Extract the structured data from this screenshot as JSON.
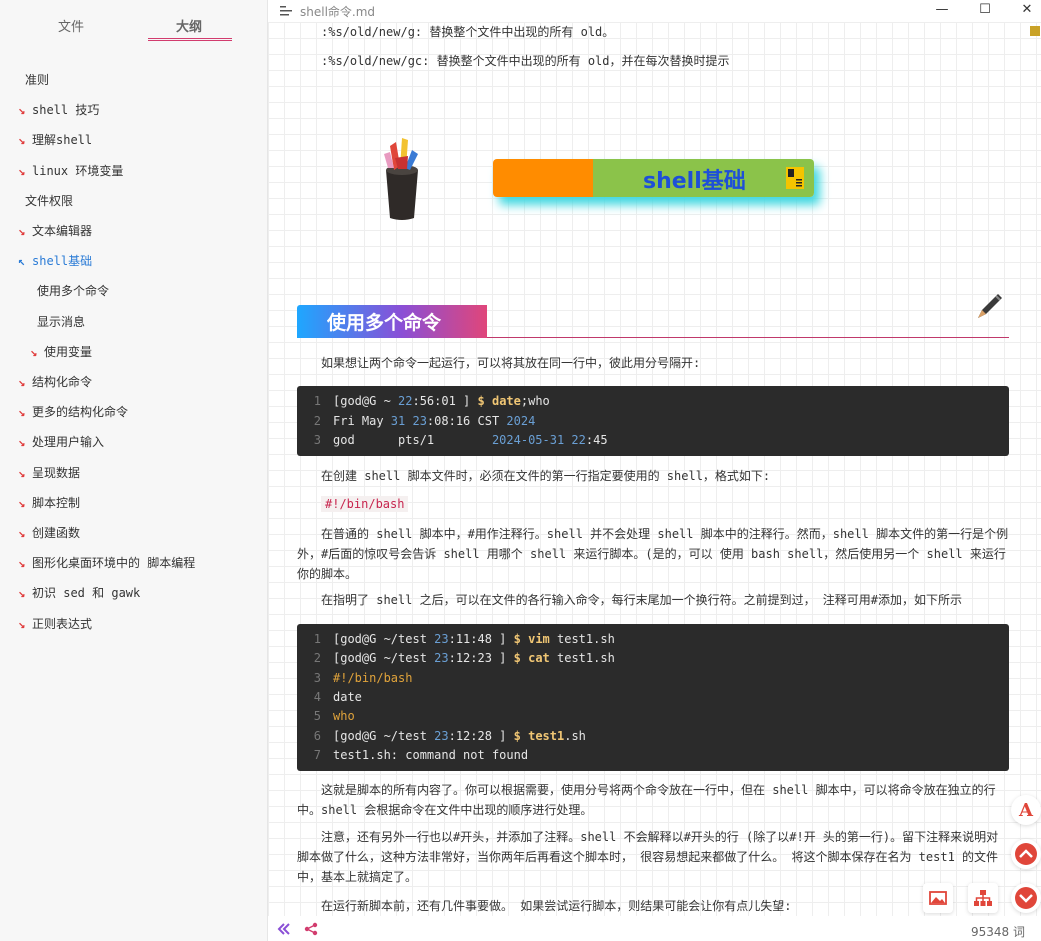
{
  "window": {
    "title": "shell命令.md",
    "minimize_glyph": "—",
    "maximize_glyph": "☐",
    "close_glyph": "✕"
  },
  "sidebar": {
    "tabs": [
      {
        "label": "文件",
        "active": false
      },
      {
        "label": "大纲",
        "active": true
      }
    ],
    "outline": [
      {
        "label": "准则",
        "level": 1,
        "collapsible": false,
        "active": false
      },
      {
        "label": "shell 技巧",
        "level": 1,
        "collapsible": true,
        "active": false
      },
      {
        "label": "理解shell",
        "level": 1,
        "collapsible": true,
        "active": false
      },
      {
        "label": "linux 环境变量",
        "level": 1,
        "collapsible": true,
        "active": false
      },
      {
        "label": "文件权限",
        "level": 1,
        "collapsible": false,
        "active": false
      },
      {
        "label": "文本编辑器",
        "level": 1,
        "collapsible": true,
        "active": false
      },
      {
        "label": "shell基础",
        "level": 1,
        "collapsible": true,
        "active": true
      },
      {
        "label": "使用多个命令",
        "level": 2,
        "collapsible": false,
        "active": false
      },
      {
        "label": "显示消息",
        "level": 2,
        "collapsible": false,
        "active": false
      },
      {
        "label": "使用变量",
        "level": 2,
        "collapsible": true,
        "active": false
      },
      {
        "label": "结构化命令",
        "level": 1,
        "collapsible": true,
        "active": false
      },
      {
        "label": "更多的结构化命令",
        "level": 1,
        "collapsible": true,
        "active": false
      },
      {
        "label": "处理用户输入",
        "level": 1,
        "collapsible": true,
        "active": false
      },
      {
        "label": "呈现数据",
        "level": 1,
        "collapsible": true,
        "active": false
      },
      {
        "label": "脚本控制",
        "level": 1,
        "collapsible": true,
        "active": false
      },
      {
        "label": "创建函数",
        "level": 1,
        "collapsible": true,
        "active": false
      },
      {
        "label": "图形化桌面环境中的 脚本编程",
        "level": 1,
        "collapsible": true,
        "active": false
      },
      {
        "label": "初识 sed 和 gawk",
        "level": 1,
        "collapsible": true,
        "active": false
      },
      {
        "label": "正则表达式",
        "level": 1,
        "collapsible": true,
        "active": false
      }
    ]
  },
  "content": {
    "vim_lines": [
      ":%s/old/new/g: 替换整个文件中出现的所有 old。",
      ":%s/old/new/gc: 替换整个文件中出现的所有 old，并在每次替换时提示"
    ],
    "banner_title": "shell基础",
    "heading": "使用多个命令",
    "para1": "如果想让两个命令一起运行，可以将其放在同一行中，彼此用分号隔开:",
    "code1": [
      {
        "n": "1",
        "parts": [
          [
            "[god@G ~ ",
            "white"
          ],
          [
            "22",
            "blue"
          ],
          [
            ":56:01 ] ",
            "white"
          ],
          [
            "$ date",
            "yellow"
          ],
          [
            ";who",
            "white"
          ]
        ]
      },
      {
        "n": "2",
        "parts": [
          [
            "Fri May ",
            "white"
          ],
          [
            "31 23",
            "blue"
          ],
          [
            ":08:16 CST ",
            "white"
          ],
          [
            "2024",
            "blue"
          ]
        ]
      },
      {
        "n": "3",
        "parts": [
          [
            "god      pts/1        ",
            "white"
          ],
          [
            "2024-05-31 22",
            "blue"
          ],
          [
            ":45",
            "white"
          ]
        ]
      }
    ],
    "para2": "在创建 shell 脚本文件时，必须在文件的第一行指定要使用的 shell，格式如下:",
    "shebang": "#!/bin/bash",
    "para3": "在普通的 shell 脚本中，#用作注释行。shell 并不会处理 shell 脚本中的注释行。然而，shell 脚本文件的第一行是个例外，#后面的惊叹号会告诉 shell 用哪个 shell 来运行脚本。(是的，可以 使用 bash shell，然后使用另一个 shell 来运行你的脚本。",
    "para4": "在指明了 shell 之后，可以在文件的各行输入命令，每行末尾加一个换行符。之前提到过， 注释可用#添加，如下所示",
    "code2": [
      {
        "n": "1",
        "parts": [
          [
            "[god@G ~/test ",
            "white"
          ],
          [
            "23",
            "blue"
          ],
          [
            ":11:48 ] ",
            "white"
          ],
          [
            "$ vim",
            "yellow"
          ],
          [
            " test1.sh",
            "white"
          ]
        ]
      },
      {
        "n": "2",
        "parts": [
          [
            "[god@G ~/test ",
            "white"
          ],
          [
            "23",
            "blue"
          ],
          [
            ":12:23 ] ",
            "white"
          ],
          [
            "$ cat",
            "yellow"
          ],
          [
            " test1.sh",
            "white"
          ]
        ]
      },
      {
        "n": "3",
        "parts": [
          [
            "#!/bin/bash",
            "orange"
          ]
        ]
      },
      {
        "n": "4",
        "parts": [
          [
            "date",
            "white"
          ]
        ]
      },
      {
        "n": "5",
        "parts": [
          [
            "who",
            "orange"
          ]
        ]
      },
      {
        "n": "6",
        "parts": [
          [
            "[god@G ~/test ",
            "white"
          ],
          [
            "23",
            "blue"
          ],
          [
            ":12:28 ] ",
            "white"
          ],
          [
            "$ test1",
            "yellow"
          ],
          [
            ".sh",
            "white"
          ]
        ]
      },
      {
        "n": "7",
        "parts": [
          [
            "test1.sh: command not found",
            "white"
          ]
        ]
      }
    ],
    "para5": "这就是脚本的所有内容了。你可以根据需要，使用分号将两个命令放在一行中，但在 shell 脚本中，可以将命令放在独立的行中。shell 会根据命令在文件中出现的顺序进行处理。",
    "para6": "注意，还有另外一行也以#开头，并添加了注释。shell 不会解释以#开头的行 (除了以#!开 头的第一行)。留下注释来说明对脚本做了什么，这种方法非常好，当你两年后再看这个脚本时， 很容易想起来都做了什么。 将这个脚本保存在名为 test1 的文件中，基本上就搞定了。",
    "para7": "在运行新脚本前，还有几件事要做。 如果尝试运行脚本，则结果可能会让你有点儿失望:"
  },
  "status": {
    "word_count": "95348 词"
  },
  "colors": {
    "accent": "#d23c6e",
    "active_outline": "#2a7bd6",
    "collapse_arrow": "#e03c3c",
    "code_bg": "#2b2b2b"
  }
}
